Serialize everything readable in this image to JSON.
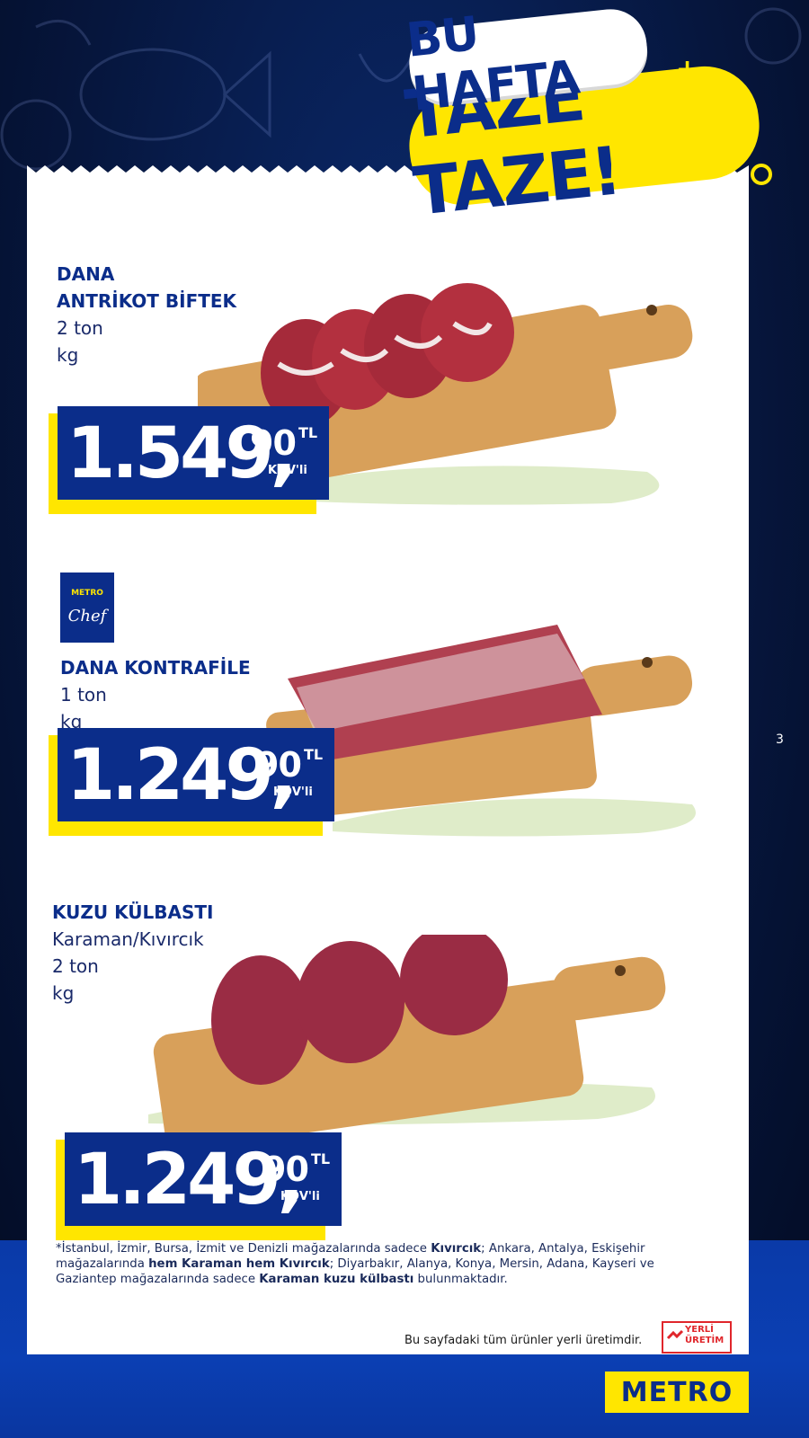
{
  "header": {
    "line1": "BU HAFTA",
    "line2": "TAZE TAZE!"
  },
  "page_number": "3",
  "products": [
    {
      "name_line1": "DANA",
      "name_line2": "ANTRİKOT BİFTEK",
      "desc_line1": "2 ton",
      "desc_line2": "kg",
      "price_main": "1.549,",
      "price_cents": "90",
      "currency": "TL",
      "tax": "KDV'li"
    },
    {
      "brand_top": "METRO",
      "brand_bottom": "Chef",
      "name_line1": "DANA KONTRAFİLE",
      "desc_line1": "1 ton",
      "desc_line2": "kg",
      "price_main": "1.249,",
      "price_cents": "90",
      "currency": "TL",
      "tax": "KDV'li"
    },
    {
      "name_line1": "KUZU KÜLBASTI",
      "desc_line1": "Karaman/Kıvırcık",
      "desc_line2": "2 ton",
      "desc_line3": "kg",
      "price_main": "1.249,",
      "price_cents": "90",
      "currency": "TL",
      "tax": "KDV'li"
    }
  ],
  "footnote": {
    "p1": "*İstanbul, İzmir, Bursa, İzmit ve Denizli mağazalarında sadece ",
    "b1": "Kıvırcık",
    "p2": "; Ankara, Antalya, Eskişehir mağazalarında ",
    "b2": "hem Karaman hem Kıvırcık",
    "p3": "; Diyarbakır, Alanya, Konya, Mersin, Adana, Kayseri ve Gaziantep mağazalarında sadece ",
    "b3": "Karaman kuzu külbastı",
    "p4": " bulunmaktadır."
  },
  "local_note": "Bu sayfadaki tüm ürünler yerli üretimdir.",
  "local_badge": {
    "line1": "YERLİ",
    "line2": "ÜRETİM"
  },
  "logo": "METRO",
  "colors": {
    "brand_blue": "#0b2d8a",
    "brand_yellow": "#ffe600",
    "badge_red": "#e0262b"
  }
}
